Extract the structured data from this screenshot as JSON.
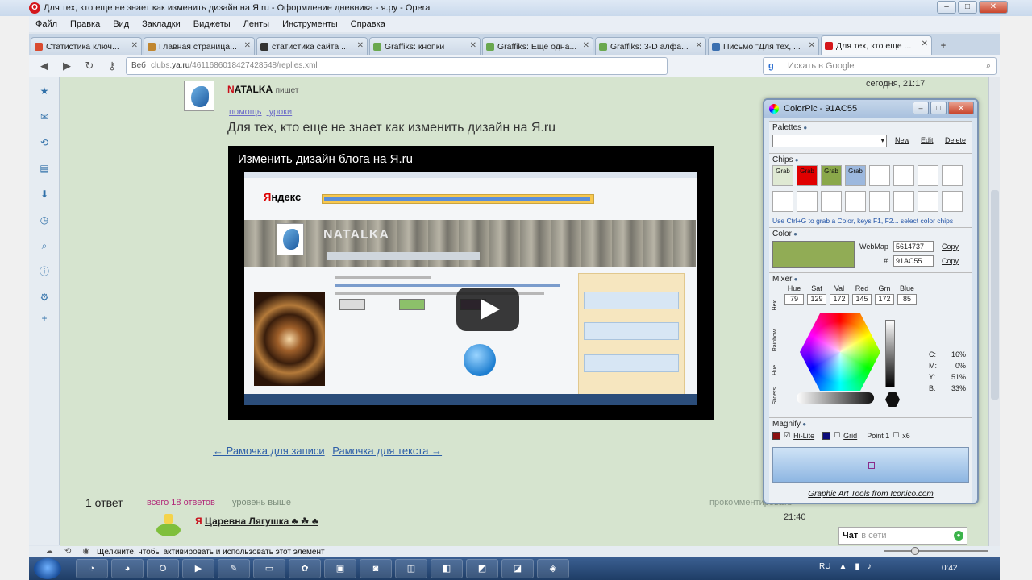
{
  "window": {
    "title": "Для тех, кто еще не знает как изменить дизайн на Я.ru - Оформление дневника - я.ру - Opera",
    "badge": "O"
  },
  "menu": [
    "Файл",
    "Правка",
    "Вид",
    "Закладки",
    "Виджеты",
    "Ленты",
    "Инструменты",
    "Справка"
  ],
  "tabs": [
    {
      "label": "Статистика ключ...",
      "color": "#d94a2f"
    },
    {
      "label": "Главная страница...",
      "color": "#c0862f"
    },
    {
      "label": "статистика сайта ...",
      "color": "#333333"
    },
    {
      "label": "Graffiks: кнопки",
      "color": "#6aa84f"
    },
    {
      "label": "Graffiks: Еще одна...",
      "color": "#6aa84f"
    },
    {
      "label": "Graffiks: 3-D алфа...",
      "color": "#6aa84f"
    },
    {
      "label": "Письмо \"Для тех, ...",
      "color": "#3a6fb0"
    },
    {
      "label": "Для тех, кто еще ...",
      "color": "#d4161b"
    }
  ],
  "nav": {
    "address_prefix": "Веб",
    "address_host_pre": "clubs.",
    "address_host": "ya.ru",
    "address_path": "/4611686018427428548/replies.xml",
    "search_placeholder": "Искать в Google",
    "search_engine_icon": "g-icon"
  },
  "post": {
    "author_first": "N",
    "author_rest": "ATALKA",
    "says": "пишет",
    "tags": [
      "помощь",
      "уроки"
    ],
    "title": "Для тех, кто еще не знает как изменить дизайн на Я.ru",
    "datetime": "сегодня, 21:17",
    "datetime2": "",
    "video_title": "Изменить дизайн блога на Я.ru",
    "video_yandex_first": "Я",
    "video_yandex_rest": "ндекс",
    "video_banner_name": "NATALKA",
    "prev_link": "← Рамочка для записи",
    "next_link": "Рамочка для текста →"
  },
  "answers": {
    "count_label": "1 ответ",
    "all_label": "всего 18 ответов",
    "level_up": "уровень выше",
    "comment": "прокомментировать",
    "time": "21:40",
    "reply_author_first": "Я",
    "reply_author_rest": "Царевна Лягушка ♣ ☘ ♣"
  },
  "chat": {
    "label": "Чат",
    "status": "в сети"
  },
  "colorpic": {
    "title": "ColorPic - 91AC55",
    "palettes_label": "Palettes",
    "new_label": "New",
    "edit_label": "Edit",
    "delete_label": "Delete",
    "chips_label": "Chips",
    "chip_grab": "Grab",
    "chip_colors": [
      "#dfe9d3",
      "#e00000",
      "#8aa84a",
      "#9cb8de"
    ],
    "chips_tip": "Use Ctrl+G to grab a Color, keys F1, F2... select color chips",
    "color_label": "Color",
    "current_color": "#91AC55",
    "webmap_label": "WebMap",
    "webmap_value": "5614737",
    "hex_label": "#",
    "hex_value": "91AC55",
    "copy_label": "Copy",
    "mixer_label": "Mixer",
    "mixer_tabs": [
      "Hex",
      "Rainbow",
      "Hue",
      "Sliders"
    ],
    "mixer": [
      {
        "name": "Hue",
        "value": "79"
      },
      {
        "name": "Sat",
        "value": "129"
      },
      {
        "name": "Val",
        "value": "172"
      },
      {
        "name": "Red",
        "value": "145"
      },
      {
        "name": "Grn",
        "value": "172"
      },
      {
        "name": "Blue",
        "value": "85"
      }
    ],
    "cmyk": [
      {
        "k": "C:",
        "v": "16%"
      },
      {
        "k": "M:",
        "v": "0%"
      },
      {
        "k": "Y:",
        "v": "51%"
      },
      {
        "k": "B:",
        "v": "33%"
      }
    ],
    "magnify_label": "Magnify",
    "hilite_label": "Hi-Lite",
    "grid_label": "Grid",
    "point_label": "Point 1",
    "x_label": "x6",
    "footer": "Graphic Art Tools from Iconico.com"
  },
  "status": {
    "text": "Щелкните, чтобы активировать и использовать этот элемент"
  },
  "taskbar": {
    "lang": "RU",
    "clock": "0:42"
  }
}
